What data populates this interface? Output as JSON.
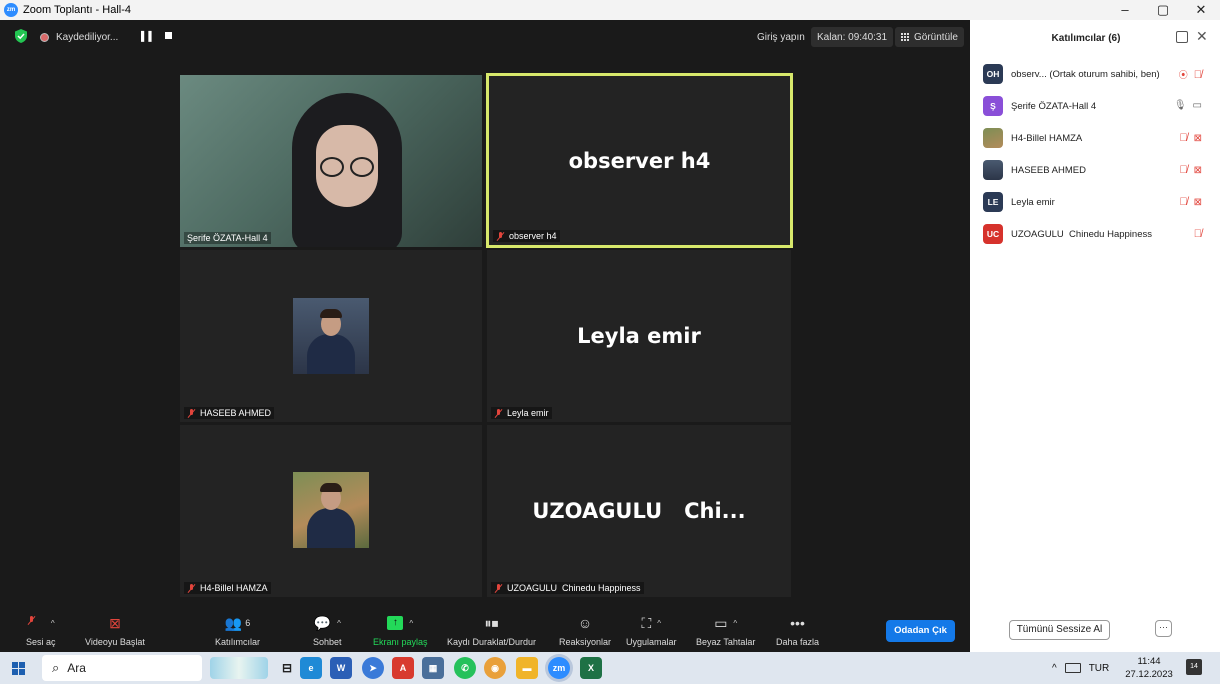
{
  "window": {
    "title": "Zoom Toplantı - Hall-4",
    "controls": [
      "–",
      "▢",
      "✕"
    ]
  },
  "topbar": {
    "recording_label": "Kaydediliyor...",
    "signin": "Giriş yapın",
    "timer": "Kalan: 09:40:31",
    "view": "Görüntüle"
  },
  "tiles": [
    {
      "name": "Şerife ÖZATA-Hall 4",
      "big": "",
      "muted": false
    },
    {
      "name": "observer h4",
      "big": "observer h4",
      "muted": true
    },
    {
      "name": "HASEEB AHMED",
      "big": "",
      "muted": true
    },
    {
      "name": "Leyla emir",
      "big": "Leyla emir",
      "muted": true
    },
    {
      "name": "H4-Billel HAMZA",
      "big": "",
      "muted": true
    },
    {
      "name": "UZOAGULU  Chinedu Happiness",
      "big": "UZOAGULU   Chi...",
      "muted": true
    }
  ],
  "toolbar": {
    "audio": "Sesi aç",
    "video": "Videoyu Başlat",
    "participants": "Katılımcılar",
    "participants_count": "6",
    "chat": "Sohbet",
    "share": "Ekranı paylaş",
    "record": "Kaydı Duraklat/Durdur",
    "reactions": "Reaksiyonlar",
    "apps": "Uygulamalar",
    "whiteboard": "Beyaz Tahtalar",
    "more": "Daha fazla",
    "leave": "Odadan Çık"
  },
  "panel": {
    "title": "Katılımcılar (6)",
    "participants": [
      {
        "initials": "OH",
        "name": "observ...  (Ortak oturum sahibi, ben)",
        "color": "#2b3a55"
      },
      {
        "initials": "Ş",
        "name": "Şerife ÖZATA-Hall 4",
        "color": "#8a4fd8"
      },
      {
        "initials": "",
        "name": "H4-Billel HAMZA",
        "color": "#6d7b5e"
      },
      {
        "initials": "",
        "name": "HASEEB AHMED",
        "color": "#2f3e66"
      },
      {
        "initials": "LE",
        "name": "Leyla emir",
        "color": "#2b3a55"
      },
      {
        "initials": "UC",
        "name": "UZOAGULU  Chinedu Happiness",
        "color": "#d6322c"
      }
    ],
    "mute_all": "Tümünü Sessize Al",
    "more": "···"
  },
  "taskbar": {
    "search": "Ara",
    "lang": "TUR",
    "time": "11:44",
    "date": "27.12.2023",
    "notifications": "14"
  }
}
